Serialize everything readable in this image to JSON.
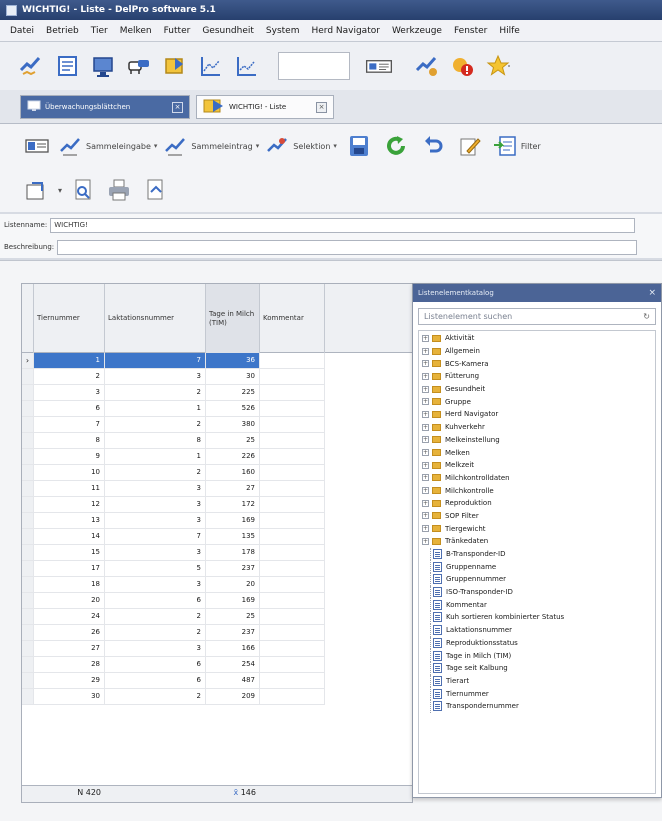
{
  "window": {
    "title": "WICHTIG! - Liste - DelPro software 5.1"
  },
  "menu": [
    "Datei",
    "Betrieb",
    "Tier",
    "Melken",
    "Futter",
    "Gesundheit",
    "System",
    "Herd Navigator",
    "Werkzeuge",
    "Fenster",
    "Hilfe"
  ],
  "tabs": [
    {
      "label": "Überwachungsblättchen"
    },
    {
      "label": "WICHTIG! - Liste"
    }
  ],
  "toolbar2": {
    "sammeleingabe": "Sammeleingabe",
    "sammeleintrag": "Sammeleintrag",
    "selektion": "Selektion",
    "filter": "Filter"
  },
  "form": {
    "listenname_label": "Listenname:",
    "listenname_value": "WICHTIG!",
    "beschreibung_label": "Beschreibung:",
    "beschreibung_value": ""
  },
  "grid": {
    "headers": [
      "Tiernummer",
      "Laktationsnummer",
      "Tage in Milch (TIM)",
      "Kommentar"
    ],
    "rows": [
      [
        "1",
        "7",
        "36",
        ""
      ],
      [
        "2",
        "3",
        "30",
        ""
      ],
      [
        "3",
        "2",
        "225",
        ""
      ],
      [
        "6",
        "1",
        "526",
        ""
      ],
      [
        "7",
        "2",
        "380",
        ""
      ],
      [
        "8",
        "8",
        "25",
        ""
      ],
      [
        "9",
        "1",
        "226",
        ""
      ],
      [
        "10",
        "2",
        "160",
        ""
      ],
      [
        "11",
        "3",
        "27",
        ""
      ],
      [
        "12",
        "3",
        "172",
        ""
      ],
      [
        "13",
        "3",
        "169",
        ""
      ],
      [
        "14",
        "7",
        "135",
        ""
      ],
      [
        "15",
        "3",
        "178",
        ""
      ],
      [
        "17",
        "5",
        "237",
        ""
      ],
      [
        "18",
        "3",
        "20",
        ""
      ],
      [
        "20",
        "6",
        "169",
        ""
      ],
      [
        "24",
        "2",
        "25",
        ""
      ],
      [
        "26",
        "2",
        "237",
        ""
      ],
      [
        "27",
        "3",
        "166",
        ""
      ],
      [
        "28",
        "6",
        "254",
        ""
      ],
      [
        "29",
        "6",
        "487",
        ""
      ],
      [
        "30",
        "2",
        "209",
        ""
      ]
    ],
    "footer_count": "N 420",
    "footer_avg": "146"
  },
  "popup": {
    "title": "Listenelementkatalog",
    "search_placeholder": "Listenelement suchen",
    "folders": [
      "Aktivität",
      "Allgemein",
      "BCS-Kamera",
      "Fütterung",
      "Gesundheit",
      "Gruppe",
      "Herd Navigator",
      "Kuhverkehr",
      "Melkeinstellung",
      "Melken",
      "Melkzeit",
      "Milchkontrolldaten",
      "Milchkontrolle",
      "Reproduktion",
      "SOP Filter",
      "Tiergewicht",
      "Tränkedaten"
    ],
    "fields": [
      "B-Transponder-ID",
      "Gruppenname",
      "Gruppennummer",
      "ISO-Transponder-ID",
      "Kommentar",
      "Kuh sortieren kombinierter Status",
      "Laktationsnummer",
      "Reproduktionsstatus",
      "Tage in Milch (TIM)",
      "Tage seit Kalbung",
      "Tierart",
      "Tiernummer",
      "Transpondernummer"
    ]
  }
}
